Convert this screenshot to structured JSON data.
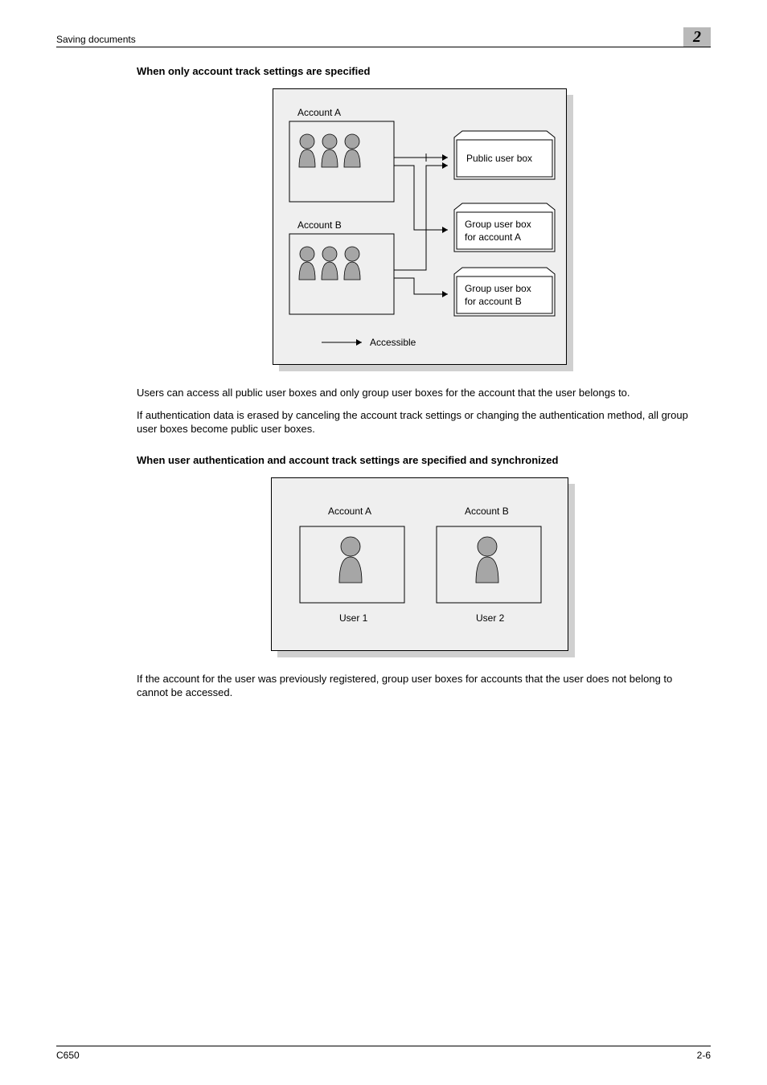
{
  "header": {
    "section": "Saving documents",
    "chapter_no": "2"
  },
  "section1": {
    "title": "When only account track settings are specified",
    "diagram": {
      "account_a": "Account A",
      "account_b": "Account B",
      "public_box": "Public user box",
      "group_box_a_l1": "Group user box",
      "group_box_a_l2": "for account A",
      "group_box_b_l1": "Group user box",
      "group_box_b_l2": "for account B",
      "legend": "Accessible"
    },
    "para1": "Users can access all public user boxes and only group user boxes for the account that the user belongs to.",
    "para2": "If authentication data is erased by canceling the account track settings or changing the authentication method, all group user boxes become public user boxes."
  },
  "section2": {
    "title": "When user authentication and account track settings are specified and synchronized",
    "diagram": {
      "account_a": "Account A",
      "account_b": "Account B",
      "user1": "User 1",
      "user2": "User 2"
    },
    "para1": "If the account for the user was previously registered, group user boxes for accounts that the user does not belong to cannot be accessed."
  },
  "footer": {
    "left": "C650",
    "right": "2-6"
  }
}
